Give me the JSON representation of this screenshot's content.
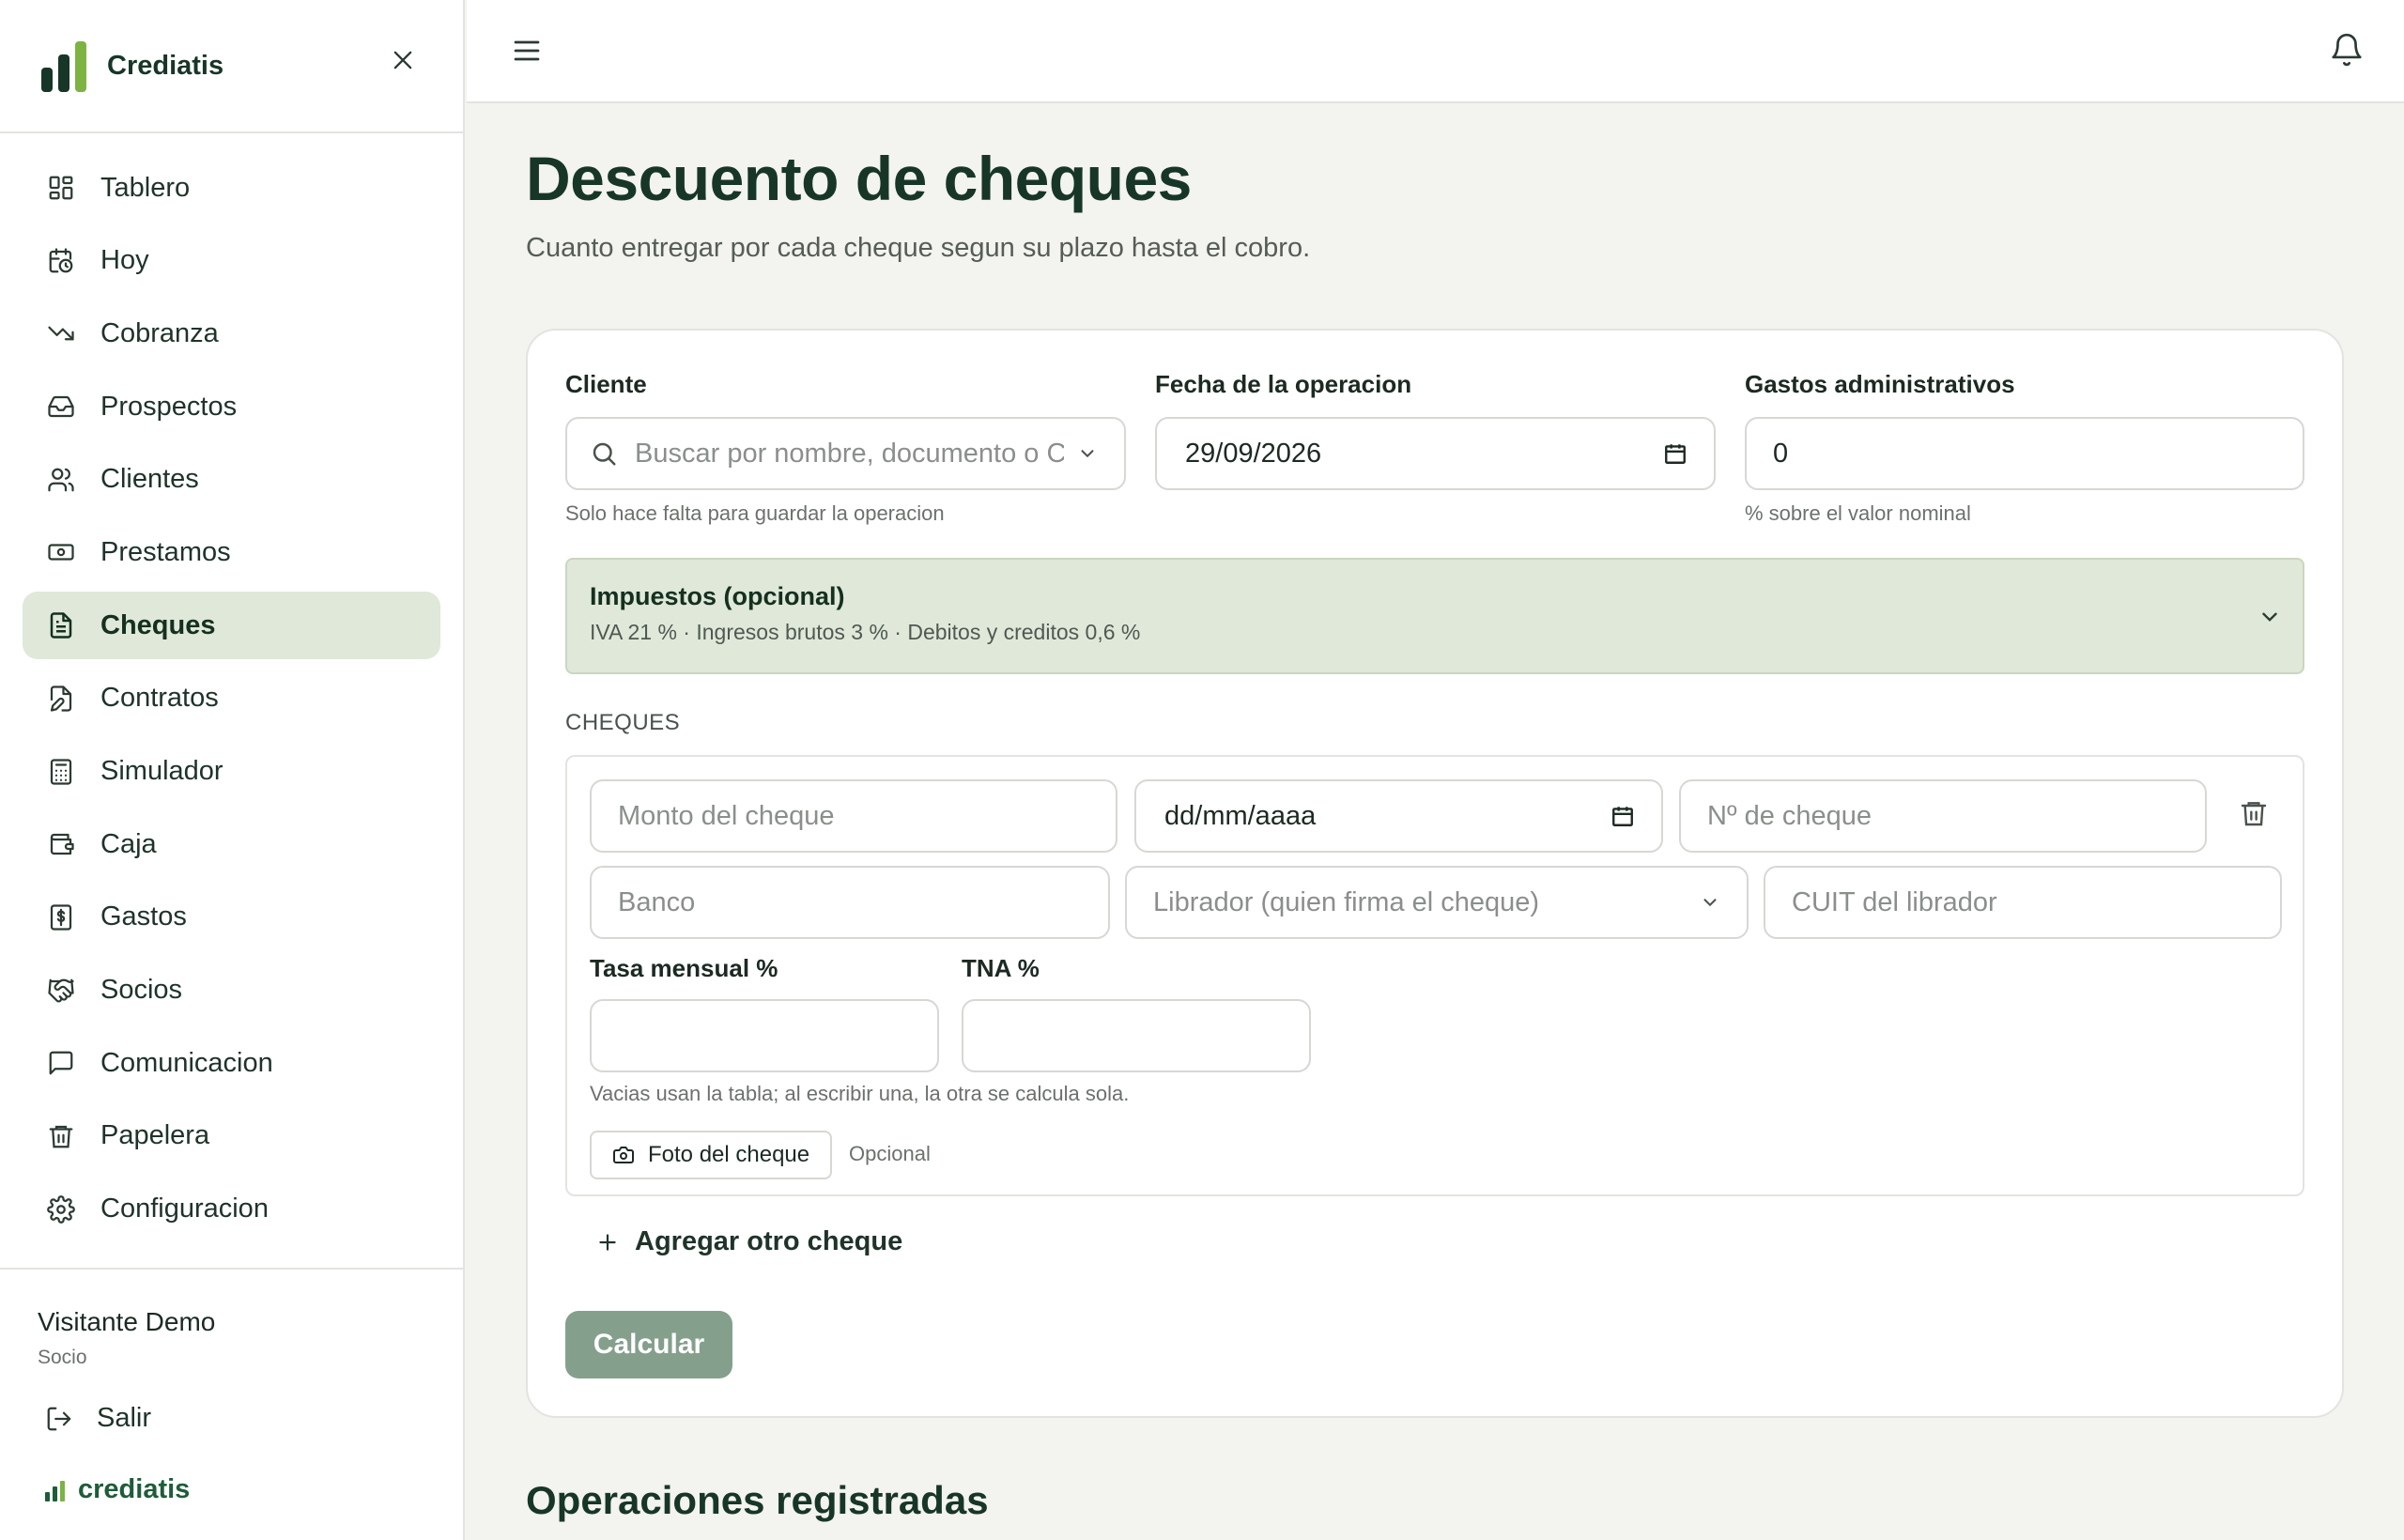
{
  "colors": {
    "brand": "#173628",
    "accent": "#1f5c3a",
    "active_bg": "#dfe8d9",
    "button": "#84a08d",
    "background": "#f3f3ef"
  },
  "app": {
    "name": "Crediatis",
    "footer_brand": "crediatis"
  },
  "sidebar": {
    "items": [
      {
        "label": "Tablero",
        "icon": "dashboard-icon"
      },
      {
        "label": "Hoy",
        "icon": "calendar-clock-icon"
      },
      {
        "label": "Cobranza",
        "icon": "trending-down-icon"
      },
      {
        "label": "Prospectos",
        "icon": "inbox-icon"
      },
      {
        "label": "Clientes",
        "icon": "users-icon"
      },
      {
        "label": "Prestamos",
        "icon": "banknote-icon"
      },
      {
        "label": "Cheques",
        "icon": "file-text-icon",
        "active": true
      },
      {
        "label": "Contratos",
        "icon": "file-edit-icon"
      },
      {
        "label": "Simulador",
        "icon": "calculator-icon"
      },
      {
        "label": "Caja",
        "icon": "wallet-icon"
      },
      {
        "label": "Gastos",
        "icon": "receipt-dollar-icon"
      },
      {
        "label": "Socios",
        "icon": "handshake-icon"
      },
      {
        "label": "Comunicacion",
        "icon": "message-square-icon"
      },
      {
        "label": "Papelera",
        "icon": "trash-icon"
      },
      {
        "label": "Configuracion",
        "icon": "gear-icon"
      }
    ],
    "user": {
      "name": "Visitante Demo",
      "role": "Socio"
    },
    "logout_label": "Salir"
  },
  "page": {
    "title": "Descuento de cheques",
    "subtitle": "Cuanto entregar por cada cheque segun su plazo hasta el cobro."
  },
  "form": {
    "client": {
      "label": "Cliente",
      "placeholder": "Buscar por nombre, documento o CUIT",
      "hint": "Solo hace falta para guardar la operacion"
    },
    "date": {
      "label": "Fecha de la operacion",
      "value": "29/09/2026"
    },
    "fees": {
      "label": "Gastos administrativos",
      "value": "0",
      "hint": "% sobre el valor nominal"
    },
    "taxes": {
      "title": "Impuestos (opcional)",
      "summary": "IVA 21 % · Ingresos brutos 3 % · Debitos y creditos 0,6 %"
    },
    "cheques_section": "CHEQUES",
    "cheque": {
      "amount_placeholder": "Monto del cheque",
      "date_placeholder": "dd/mm/aaaa",
      "number_placeholder": "Nº de cheque",
      "bank_placeholder": "Banco",
      "drawer_placeholder": "Librador (quien firma el cheque)",
      "cuit_placeholder": "CUIT del librador",
      "monthly_rate_label": "Tasa mensual %",
      "tna_label": "TNA %",
      "rates_hint": "Vacias usan la tabla; al escribir una, la otra se calcula sola.",
      "photo_label": "Foto del cheque",
      "photo_optional": "Opcional"
    },
    "add_label": "Agregar otro cheque",
    "calculate_label": "Calcular"
  },
  "operations": {
    "title": "Operaciones registradas"
  }
}
